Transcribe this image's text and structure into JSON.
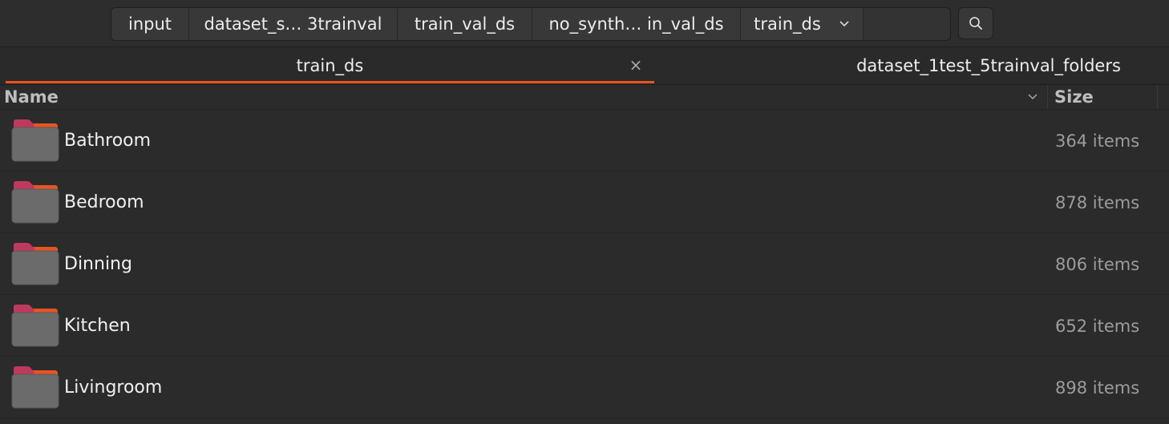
{
  "breadcrumbs": {
    "items": [
      {
        "label": "input"
      },
      {
        "label": "dataset_s… 3trainval"
      },
      {
        "label": "train_val_ds"
      },
      {
        "label": "no_synth… in_val_ds"
      },
      {
        "label": "train_ds"
      }
    ],
    "current_dropdown_icon": "chevron-down-icon",
    "search_icon": "search-icon"
  },
  "tabs": {
    "items": [
      {
        "label": "train_ds",
        "active": true,
        "close_glyph": "×"
      },
      {
        "label": "dataset_1test_5trainval_folders",
        "active": false
      }
    ],
    "accent": "#e95420"
  },
  "columns": {
    "name": "Name",
    "size": "Size",
    "sort_icon": "chevron-down-icon"
  },
  "files": [
    {
      "name": "Bathroom",
      "size": "364 items",
      "icon": "folder-icon"
    },
    {
      "name": "Bedroom",
      "size": "878 items",
      "icon": "folder-icon"
    },
    {
      "name": "Dinning",
      "size": "806 items",
      "icon": "folder-icon"
    },
    {
      "name": "Kitchen",
      "size": "652 items",
      "icon": "folder-icon"
    },
    {
      "name": "Livingroom",
      "size": "898 items",
      "icon": "folder-icon"
    }
  ],
  "colors": {
    "folder_tab_top": "#c0395d",
    "folder_tab_orange": "#e95420",
    "folder_body": "#6b6b6b"
  }
}
